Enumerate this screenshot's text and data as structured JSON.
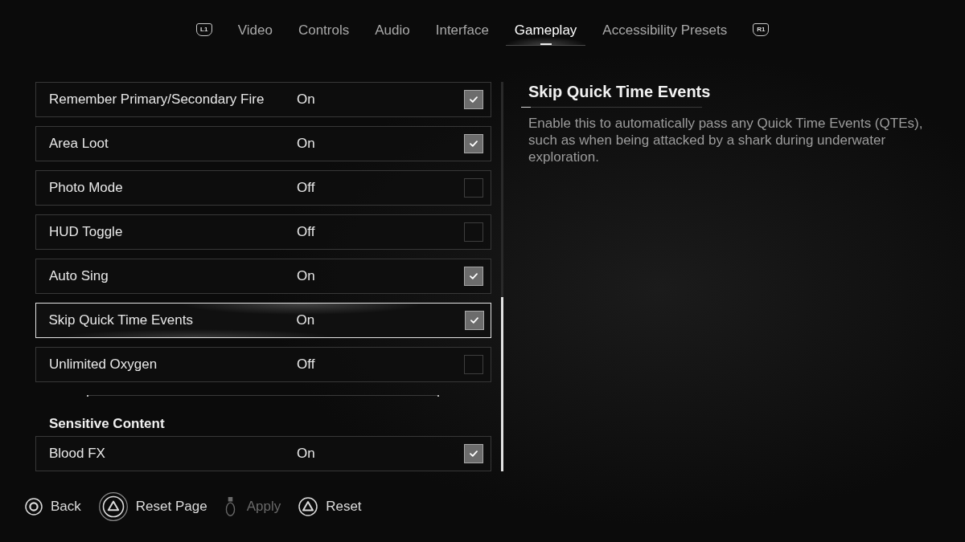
{
  "tabs": {
    "prev_button": "L1",
    "items": [
      {
        "label": "Video",
        "selected": false
      },
      {
        "label": "Controls",
        "selected": false
      },
      {
        "label": "Audio",
        "selected": false
      },
      {
        "label": "Interface",
        "selected": false
      },
      {
        "label": "Gameplay",
        "selected": true
      },
      {
        "label": "Accessibility Presets",
        "selected": false
      }
    ],
    "next_button": "R1"
  },
  "settings": {
    "rows": [
      {
        "label": "Remember Primary/Secondary Fire",
        "value": "On",
        "checked": true,
        "selected": false
      },
      {
        "label": "Area Loot",
        "value": "On",
        "checked": true,
        "selected": false
      },
      {
        "label": "Photo Mode",
        "value": "Off",
        "checked": false,
        "selected": false
      },
      {
        "label": "HUD Toggle",
        "value": "Off",
        "checked": false,
        "selected": false
      },
      {
        "label": "Auto Sing",
        "value": "On",
        "checked": true,
        "selected": false
      },
      {
        "label": "Skip Quick Time Events",
        "value": "On",
        "checked": true,
        "selected": true
      },
      {
        "label": "Unlimited Oxygen",
        "value": "Off",
        "checked": false,
        "selected": false
      }
    ],
    "sections": [
      {
        "heading": "Sensitive Content",
        "rows": [
          {
            "label": "Blood FX",
            "value": "On",
            "checked": true,
            "selected": false
          }
        ]
      }
    ]
  },
  "detail": {
    "title": "Skip Quick Time Events",
    "description": "Enable this to automatically pass any Quick Time Events (QTEs), such as when being attacked by a shark during underwater exploration."
  },
  "footer": {
    "actions": [
      {
        "kind": "circle",
        "label": "Back",
        "disabled": false
      },
      {
        "kind": "triangle_hold",
        "label": "Reset Page",
        "disabled": false
      },
      {
        "kind": "touchpad",
        "label": "Apply",
        "disabled": true
      },
      {
        "kind": "triangle",
        "label": "Reset",
        "disabled": false
      }
    ]
  }
}
